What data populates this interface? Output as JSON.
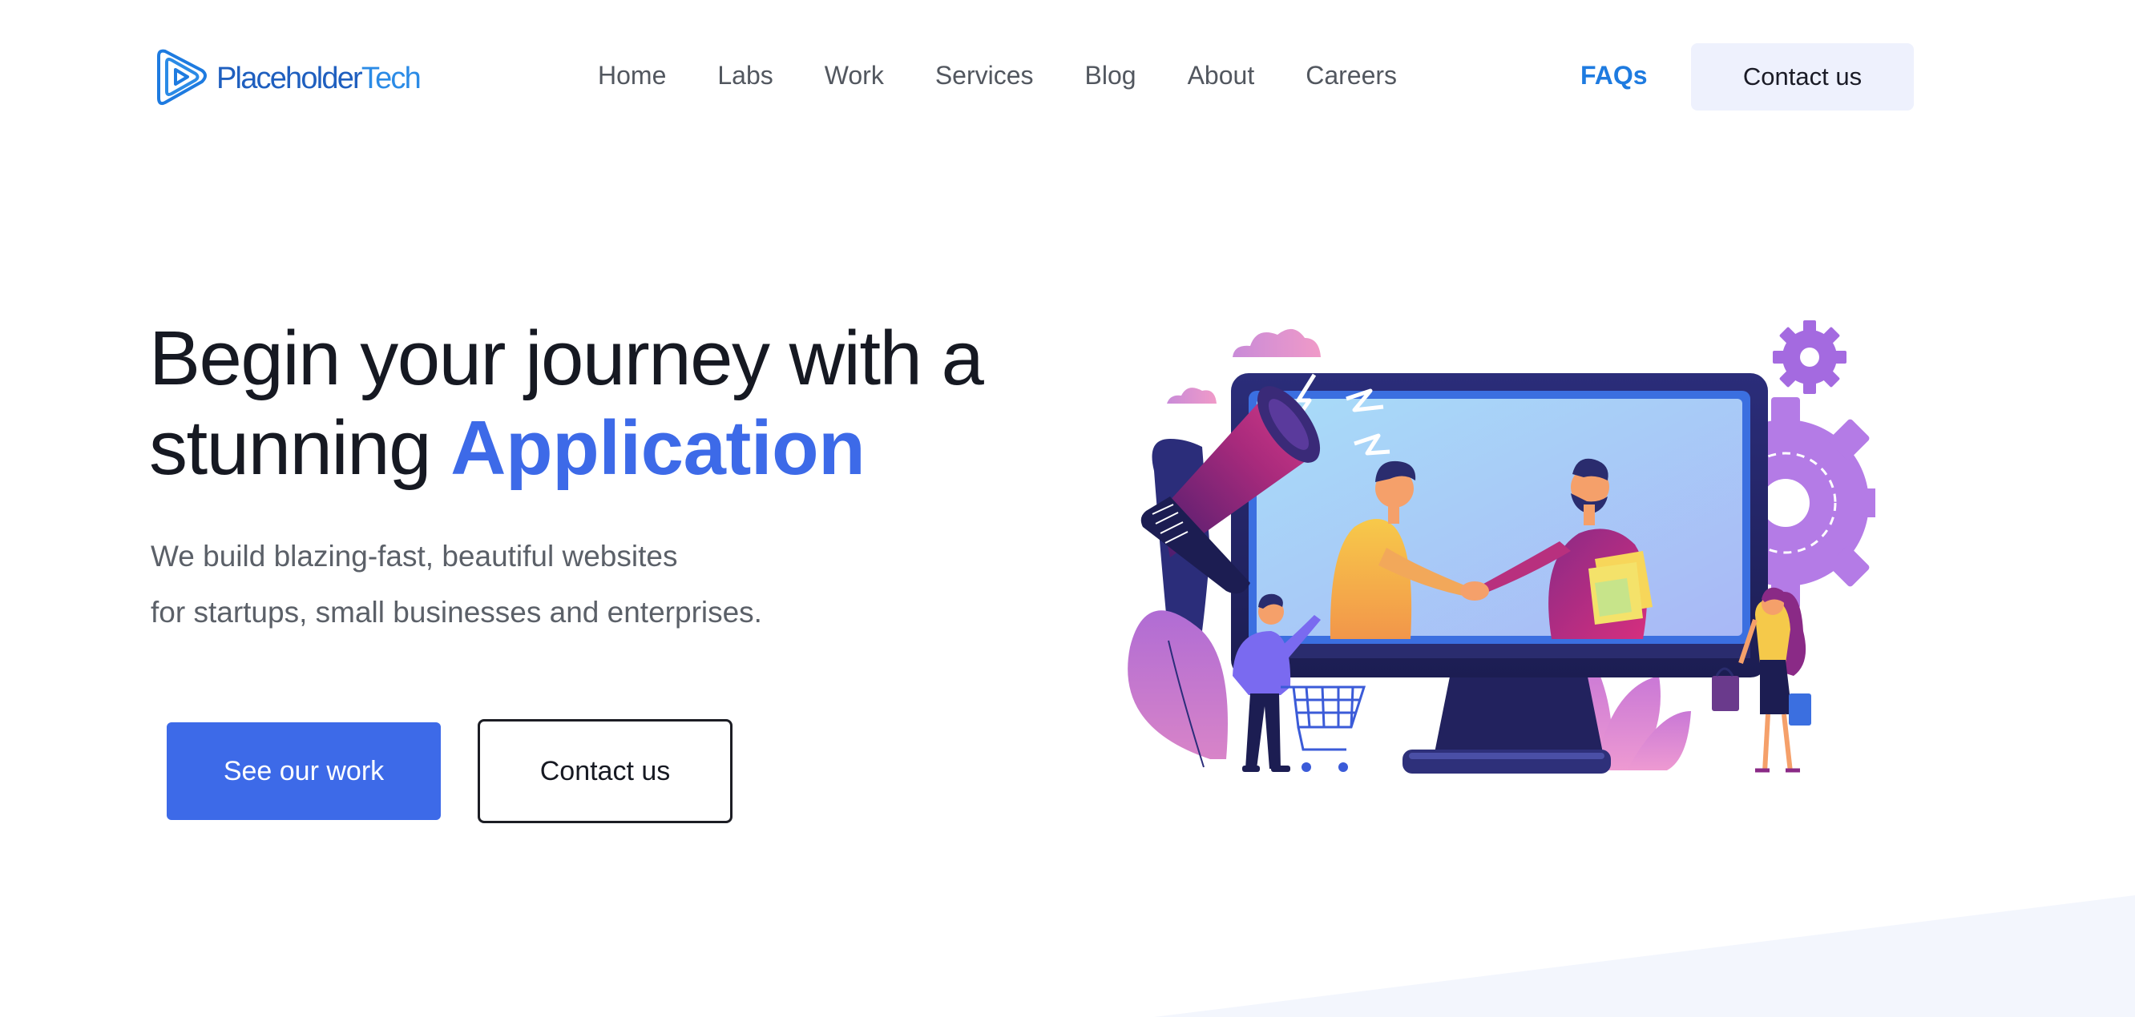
{
  "brand": {
    "name_part1": "Placeholder",
    "name_part2": "Tech"
  },
  "nav": {
    "items": [
      {
        "label": "Home"
      },
      {
        "label": "Labs"
      },
      {
        "label": "Work"
      },
      {
        "label": "Services"
      },
      {
        "label": "Blog"
      },
      {
        "label": "About"
      },
      {
        "label": "Careers"
      }
    ],
    "faqs_label": "FAQs",
    "contact_label": "Contact us"
  },
  "hero": {
    "title_line1": "Begin your journey with a",
    "title_line2_prefix": "stunning",
    "title_line2_accent": "Application",
    "subtitle_line1": "We build blazing-fast, beautiful websites",
    "subtitle_line2": "for startups, small businesses and enterprises.",
    "primary_cta": "See our work",
    "secondary_cta": "Contact us",
    "illustration_icon": "handshake-on-monitor-illustration"
  },
  "colors": {
    "accent": "#3d6ae8",
    "brand_blue": "#1f5fbf",
    "link_blue": "#1e7be0",
    "nav_text": "#52575f",
    "heading": "#161922",
    "subtitle": "#5b6068",
    "header_cta_bg": "#eef1fd"
  }
}
